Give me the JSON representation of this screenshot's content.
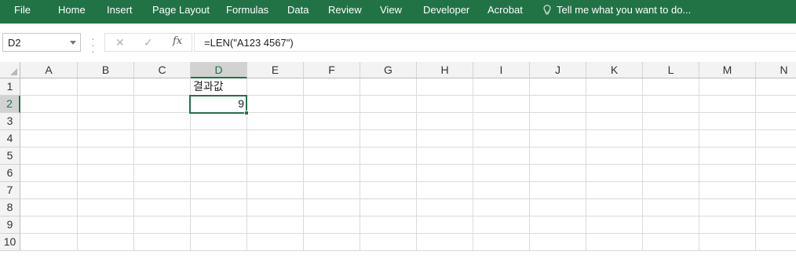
{
  "ribbon": {
    "tabs": [
      "File",
      "Home",
      "Insert",
      "Page Layout",
      "Formulas",
      "Data",
      "Review",
      "View",
      "Developer",
      "Acrobat"
    ],
    "tell_me": "Tell me what you want to do...",
    "color": "#217346"
  },
  "formula_bar": {
    "name_box": "D2",
    "formula": "=LEN(\"A123 4567\")",
    "cancel_icon": "✕",
    "enter_icon": "✓",
    "fx_label": "fx"
  },
  "grid": {
    "columns": [
      "A",
      "B",
      "C",
      "D",
      "E",
      "F",
      "G",
      "H",
      "I",
      "J",
      "K",
      "L",
      "M",
      "N"
    ],
    "rows": [
      "1",
      "2",
      "3",
      "4",
      "5",
      "6",
      "7",
      "8",
      "9",
      "10"
    ],
    "selected_column": "D",
    "selected_row": "2",
    "cells": {
      "D1": "결과값",
      "D2": "9"
    }
  }
}
